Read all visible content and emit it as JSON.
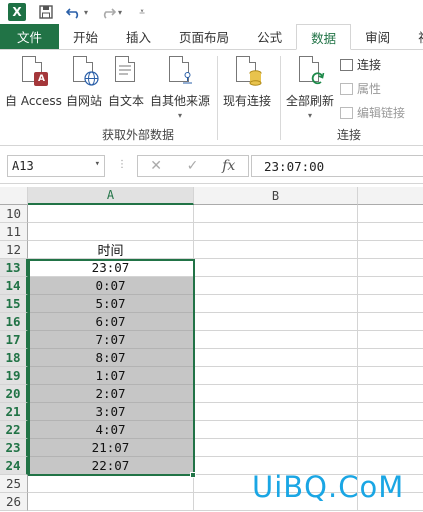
{
  "qat": {
    "app_icon": "excel-icon",
    "items": [
      "save-icon",
      "undo-icon",
      "redo-icon",
      "customize-icon"
    ]
  },
  "tabs": [
    {
      "label": "文件",
      "type": "file"
    },
    {
      "label": "开始"
    },
    {
      "label": "插入"
    },
    {
      "label": "页面布局"
    },
    {
      "label": "公式"
    },
    {
      "label": "数据",
      "active": true
    },
    {
      "label": "审阅"
    },
    {
      "label": "视"
    }
  ],
  "ribbon": {
    "external_group": {
      "label": "获取外部数据",
      "buttons": [
        "自 Access",
        "自网站",
        "自文本",
        "自其他来源"
      ]
    },
    "existing_conn_label": "现有连接",
    "refresh_all_label": "全部刷新",
    "conn_group": {
      "label": "连接",
      "items": [
        {
          "label": "连接",
          "enabled": true
        },
        {
          "label": "属性",
          "enabled": false
        },
        {
          "label": "编辑链接",
          "enabled": false
        }
      ]
    }
  },
  "formula_bar": {
    "name_box": "A13",
    "value": "23:07:00",
    "fx_label": "fx"
  },
  "sheet": {
    "columns": [
      "A",
      "B"
    ],
    "rows": [
      {
        "num": "10",
        "a": ""
      },
      {
        "num": "11",
        "a": ""
      },
      {
        "num": "12",
        "a": "时间"
      },
      {
        "num": "13",
        "a": "23:07"
      },
      {
        "num": "14",
        "a": "0:07"
      },
      {
        "num": "15",
        "a": "5:07"
      },
      {
        "num": "16",
        "a": "6:07"
      },
      {
        "num": "17",
        "a": "7:07"
      },
      {
        "num": "18",
        "a": "8:07"
      },
      {
        "num": "19",
        "a": "1:07"
      },
      {
        "num": "20",
        "a": "2:07"
      },
      {
        "num": "21",
        "a": "3:07"
      },
      {
        "num": "22",
        "a": "4:07"
      },
      {
        "num": "23",
        "a": "21:07"
      },
      {
        "num": "24",
        "a": "22:07"
      },
      {
        "num": "25",
        "a": ""
      },
      {
        "num": "26",
        "a": ""
      }
    ],
    "selected_range": "A13:A24"
  },
  "watermark": "UiBQ.CoM",
  "colors": {
    "accent": "#217346",
    "selection_fill": "#c6c6c6",
    "watermark": "#1aa6e4"
  }
}
